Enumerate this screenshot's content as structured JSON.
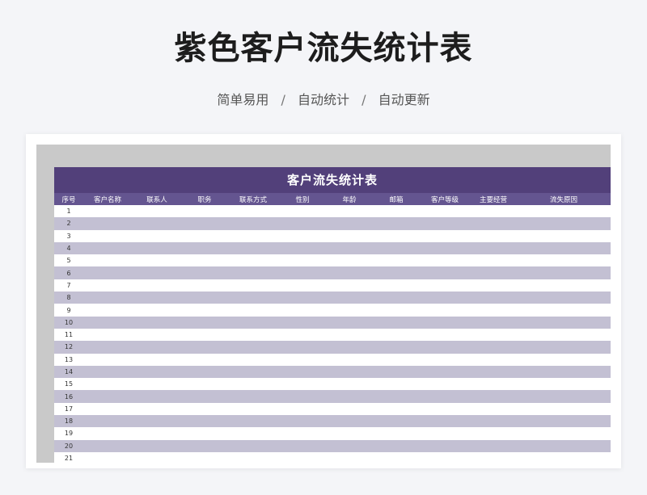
{
  "header": {
    "title": "紫色客户流失统计表",
    "tags": [
      "简单易用",
      "自动统计",
      "自动更新"
    ],
    "separator": "/"
  },
  "sheet": {
    "title": "客户流失统计表",
    "columns": [
      "序号",
      "客户名称",
      "联系人",
      "职务",
      "联系方式",
      "性别",
      "年龄",
      "邮箱",
      "客户等级",
      "主要经营",
      "流失原因"
    ],
    "rows": [
      "1",
      "2",
      "3",
      "4",
      "5",
      "6",
      "7",
      "8",
      "9",
      "10",
      "11",
      "12",
      "13",
      "14",
      "15",
      "16",
      "17",
      "18",
      "19",
      "20",
      "21"
    ]
  },
  "colors": {
    "title_bar": "#52407a",
    "header_row": "#645590",
    "stripe": "#c3c0d3",
    "frame": "#c9c9c9"
  }
}
